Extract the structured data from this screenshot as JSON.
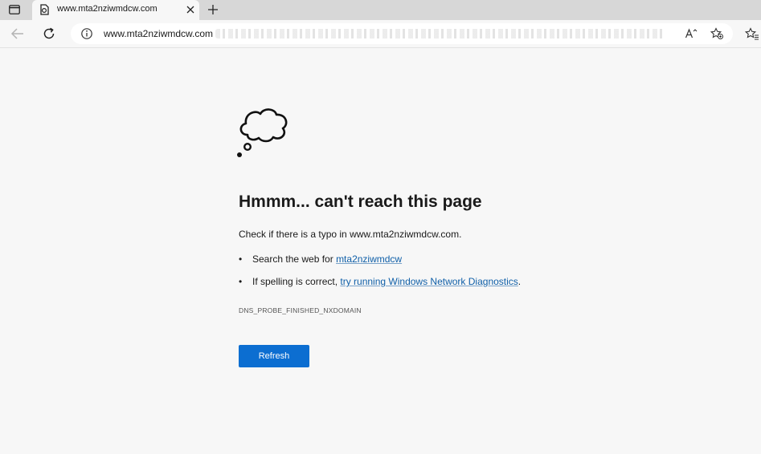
{
  "tab": {
    "title": "www.mta2nziwmdcw.com"
  },
  "toolbar": {
    "url": "www.mta2nziwmdcw.com"
  },
  "error_page": {
    "headline": "Hmmm... can't reach this page",
    "message": "Check if there is a typo in www.mta2nziwmdcw.com.",
    "bullet1_prefix": "Search the web for ",
    "bullet1_link": "mta2nziwmdcw",
    "bullet2_prefix": "If spelling is correct, ",
    "bullet2_link": "try running Windows Network Diagnostics",
    "bullet2_suffix": ".",
    "bullet_glyph": "•",
    "error_code": "DNS_PROBE_FINISHED_NXDOMAIN",
    "refresh_label": "Refresh"
  },
  "icons": {
    "tab_actions": "tab-actions-icon",
    "favicon": "error-page-icon",
    "close": "close-icon",
    "new_tab": "plus-icon",
    "back": "back-arrow-icon",
    "reload": "refresh-icon",
    "info": "info-icon",
    "read_aloud": "read-aloud-icon",
    "favorite": "add-favorite-icon",
    "favorites": "favorites-icon",
    "cloud": "thought-cloud-icon"
  },
  "colors": {
    "accent": "#0c6ed1",
    "link": "#0f5fa8",
    "tabstrip": "#d7d7d7",
    "page_bg": "#f7f7f7"
  }
}
